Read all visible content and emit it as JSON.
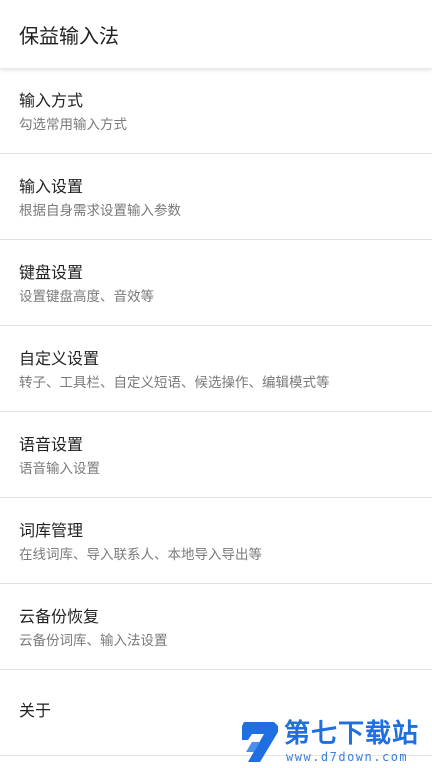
{
  "app": {
    "title": "保益输入法"
  },
  "settings": {
    "items": [
      {
        "title": "输入方式",
        "subtitle": "勾选常用输入方式"
      },
      {
        "title": "输入设置",
        "subtitle": "根据自身需求设置输入参数"
      },
      {
        "title": "键盘设置",
        "subtitle": "设置键盘高度、音效等"
      },
      {
        "title": "自定义设置",
        "subtitle": "转子、工具栏、自定义短语、候选操作、编辑模式等"
      },
      {
        "title": "语音设置",
        "subtitle": "语音输入设置"
      },
      {
        "title": "词库管理",
        "subtitle": "在线词库、导入联系人、本地导入导出等"
      },
      {
        "title": "云备份恢复",
        "subtitle": "云备份词库、输入法设置"
      },
      {
        "title": "关于"
      }
    ]
  },
  "watermark": {
    "name": "第七下载站",
    "url": "www.d7down.com",
    "color": "#1f6fe0"
  }
}
